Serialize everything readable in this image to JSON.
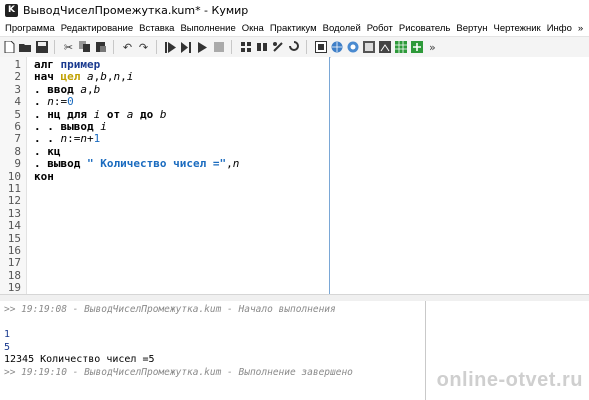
{
  "window": {
    "title": "ВыводЧиселПромежутка.kum* - Кумир",
    "app_icon": "K"
  },
  "menu": [
    "Программа",
    "Редактирование",
    "Вставка",
    "Выполнение",
    "Окна",
    "Практикум",
    "Водолей",
    "Робот",
    "Рисователь",
    "Вертун",
    "Чертежник",
    "Инфо",
    "»"
  ],
  "toolbar": {
    "icons": [
      "new-file-icon",
      "open-folder-icon",
      "save-icon",
      "cut-icon",
      "copy-icon",
      "paste-icon",
      "undo-icon",
      "redo-icon",
      "run-icon",
      "step-over-icon",
      "step-into-icon",
      "stop-icon",
      "robot-icon",
      "waterman-icon",
      "drawer-icon",
      "turtle-icon",
      "grid-icon",
      "globe-icon",
      "map-icon",
      "board-icon",
      "graph-icon",
      "green-grid-icon",
      "green-plus-grid-icon"
    ],
    "more": "»"
  },
  "editor": {
    "lines": [
      {
        "n": "1",
        "t": "алг пример"
      },
      {
        "n": "2",
        "t": "нач цел a,b,n,i"
      },
      {
        "n": "3",
        "t": ". ввод a,b"
      },
      {
        "n": "4",
        "t": ". n:=0"
      },
      {
        "n": "5",
        "t": ". нц для i от a до b"
      },
      {
        "n": "6",
        "t": ". . вывод i"
      },
      {
        "n": "7",
        "t": ". . n:=n+1"
      },
      {
        "n": "8",
        "t": ". кц"
      },
      {
        "n": "9",
        "t": ". вывод \" Количество чисел =\",n"
      },
      {
        "n": "10",
        "t": "кон"
      },
      {
        "n": "11",
        "t": ""
      },
      {
        "n": "12",
        "t": ""
      },
      {
        "n": "13",
        "t": ""
      },
      {
        "n": "14",
        "t": ""
      },
      {
        "n": "15",
        "t": ""
      },
      {
        "n": "16",
        "t": ""
      },
      {
        "n": "17",
        "t": ""
      },
      {
        "n": "18",
        "t": ""
      },
      {
        "n": "19",
        "t": ""
      }
    ]
  },
  "console": {
    "lines": [
      {
        "kind": "info",
        "text": ">> 19:19:08 - ВыводЧиселПромежутка.kum - Начало выполнения"
      },
      {
        "kind": "blank",
        "text": ""
      },
      {
        "kind": "in",
        "text": "1"
      },
      {
        "kind": "in",
        "text": "5"
      },
      {
        "kind": "out",
        "text": "12345 Количество чисел =5"
      },
      {
        "kind": "info",
        "text": ">> 19:19:10 - ВыводЧиселПромежутка.kum - Выполнение завершено"
      }
    ]
  },
  "watermark": "online-otvet.ru"
}
